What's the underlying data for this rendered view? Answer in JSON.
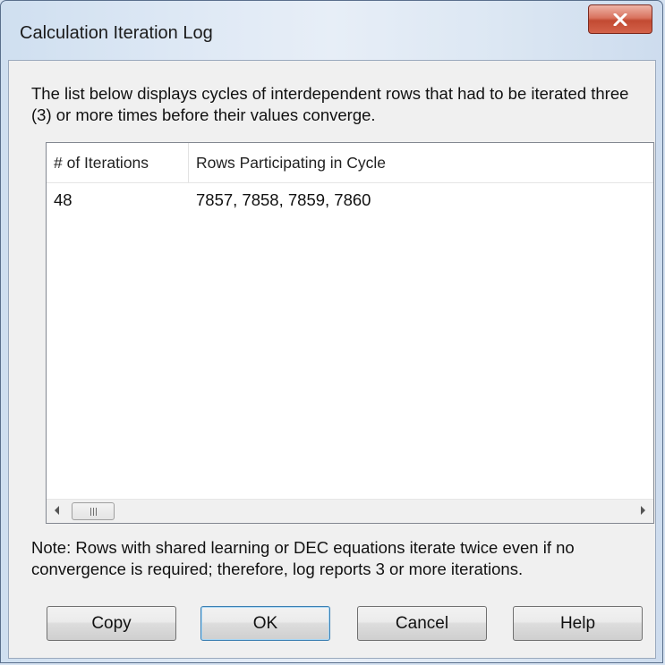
{
  "window": {
    "title": "Calculation Iteration Log"
  },
  "description": "The list below displays cycles of interdependent rows that had to be iterated three (3) or more times before their values converge.",
  "table": {
    "columns": [
      "# of Iterations",
      "Rows Participating in Cycle"
    ],
    "rows": [
      [
        "48",
        "7857, 7858, 7859, 7860"
      ]
    ]
  },
  "note": "Note: Rows with shared learning or DEC equations iterate twice even if no convergence is required; therefore, log reports 3 or more iterations.",
  "buttons": {
    "copy": "Copy",
    "ok": "OK",
    "cancel": "Cancel",
    "help": "Help"
  },
  "icons": {
    "close": "close-icon",
    "scroll_left": "chevron-left-icon",
    "scroll_right": "chevron-right-icon"
  },
  "colors": {
    "close_button": "#c94a33",
    "default_button_border": "#3c7fb1"
  }
}
